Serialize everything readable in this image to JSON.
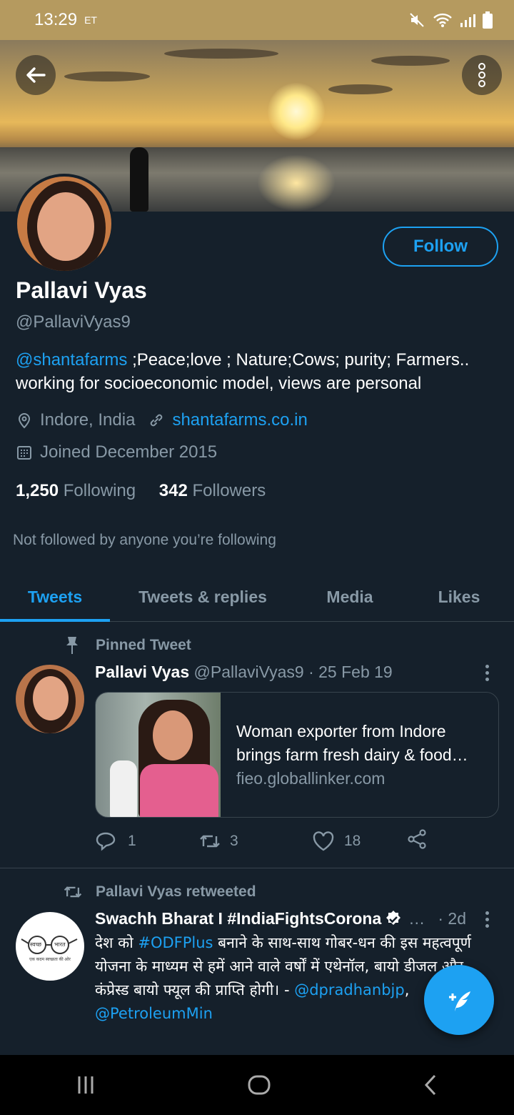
{
  "status_bar": {
    "time": "13:29",
    "sim_label": "ET"
  },
  "profile": {
    "name": "Pallavi Vyas",
    "handle": "@PallaviVyas9",
    "follow_label": "Follow",
    "bio_mention": "@shantafarms",
    "bio_text": " ;Peace;love ; Nature;Cows; purity; Farmers.. working for socioeconomic model, views are personal",
    "location": "Indore, India",
    "website": "shantafarms.co.in",
    "joined": "Joined December 2015",
    "following_count": "1,250",
    "following_label": "Following",
    "followers_count": "342",
    "followers_label": "Followers",
    "not_followed": "Not followed by anyone you’re following"
  },
  "tabs": [
    {
      "label": "Tweets",
      "active": true
    },
    {
      "label": "Tweets & replies",
      "active": false
    },
    {
      "label": "Media",
      "active": false
    },
    {
      "label": "Likes",
      "active": false
    }
  ],
  "pinned": {
    "context": "Pinned Tweet",
    "author": "Pallavi Vyas",
    "handle": "@PallaviVyas9",
    "date": "· 25 Feb 19",
    "card_title": "Woman exporter from Indore brings farm fresh dairy & food…",
    "card_domain": "fieo.globallinker.com",
    "replies": "1",
    "retweets": "3",
    "likes": "18"
  },
  "retweet": {
    "context": "Pallavi Vyas retweeted",
    "author": "Swachh Bharat I #IndiaFightsCorona",
    "ellipsis": "…",
    "date": "· 2d",
    "text_1": "देश को ",
    "hashtag": "#ODFPlus",
    "text_2": " बनाने के साथ-साथ गोबर-धन की इस महत्वपूर्ण योजना के माध्यम से हमें आने वाले वर्षों में एथेनॉल, बायो डीजल और कंप्रेस्ड बायो फ्यूल की प्राप्ति होगी। -",
    "mention_1": "@dpradhanbjp",
    "sep": ", ",
    "mention_2": "@PetroleumMin",
    "avatar_text_1": "स्वच्छ",
    "avatar_text_2": "भारत",
    "avatar_caption": "एक कदम स्वच्छता की ओर"
  },
  "colors": {
    "background": "#15202b",
    "accent": "#1da1f2",
    "muted": "#8899a6"
  },
  "icons": [
    "back-arrow-icon",
    "overflow-menu-icon",
    "location-pin-icon",
    "link-icon",
    "calendar-icon",
    "pin-icon",
    "retweet-icon",
    "reply-icon",
    "like-icon",
    "share-icon",
    "verified-badge-icon",
    "compose-tweet-icon",
    "recent-apps-icon",
    "home-icon",
    "nav-back-icon"
  ]
}
